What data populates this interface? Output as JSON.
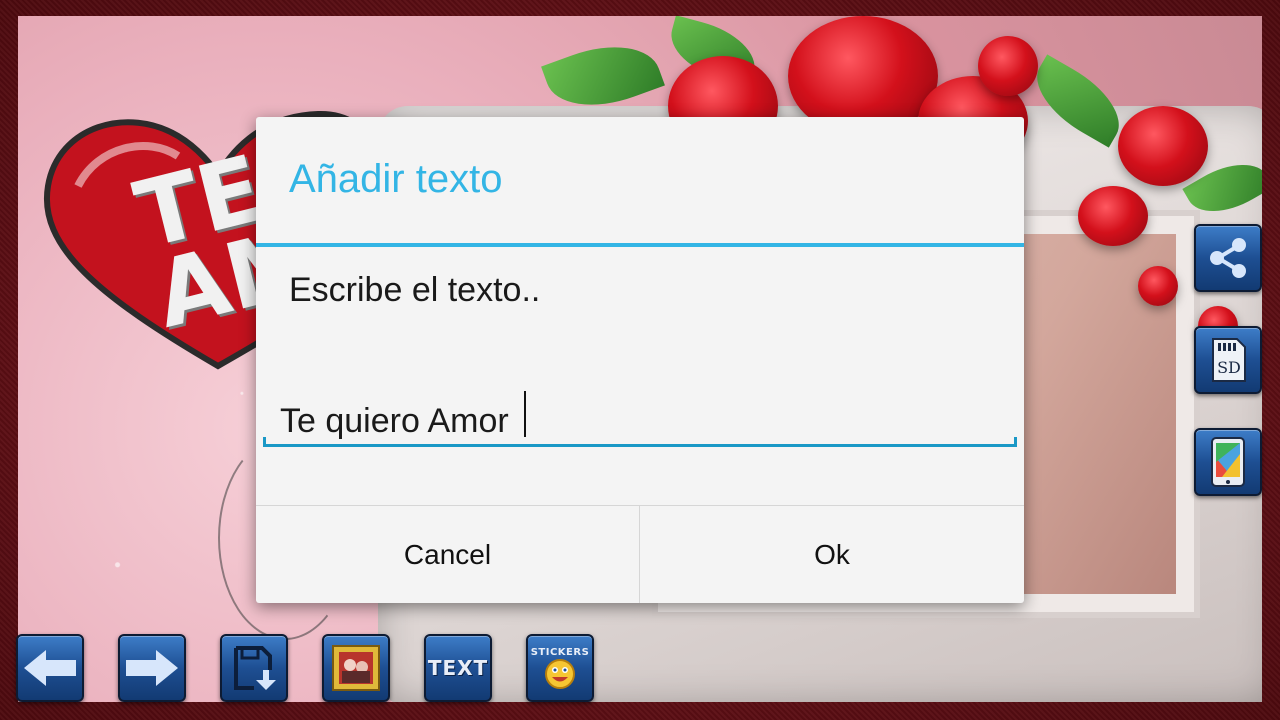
{
  "background": {
    "heart_text": "TE\nAM"
  },
  "dialog": {
    "title": "Añadir texto",
    "message": "Escribe el texto..",
    "input_value": "Te quiero Amor",
    "cancel_label": "Cancel",
    "ok_label": "Ok"
  },
  "side_toolbar": {
    "items": [
      {
        "icon": "share-icon"
      },
      {
        "icon": "sd-card-icon",
        "label": "SD"
      },
      {
        "icon": "set-wallpaper-icon"
      }
    ]
  },
  "bottom_toolbar": {
    "items": [
      {
        "icon": "arrow-left-icon"
      },
      {
        "icon": "arrow-right-icon"
      },
      {
        "icon": "save-icon"
      },
      {
        "icon": "frame-gallery-icon"
      },
      {
        "icon": "text-icon",
        "label": "TEXT"
      },
      {
        "icon": "stickers-icon",
        "label": "STICKERS"
      }
    ]
  },
  "colors": {
    "accent": "#33b5e5",
    "input_line": "#1a98c6",
    "dialog_bg": "#f4f4f4",
    "tool_button": "#1e4f93"
  }
}
